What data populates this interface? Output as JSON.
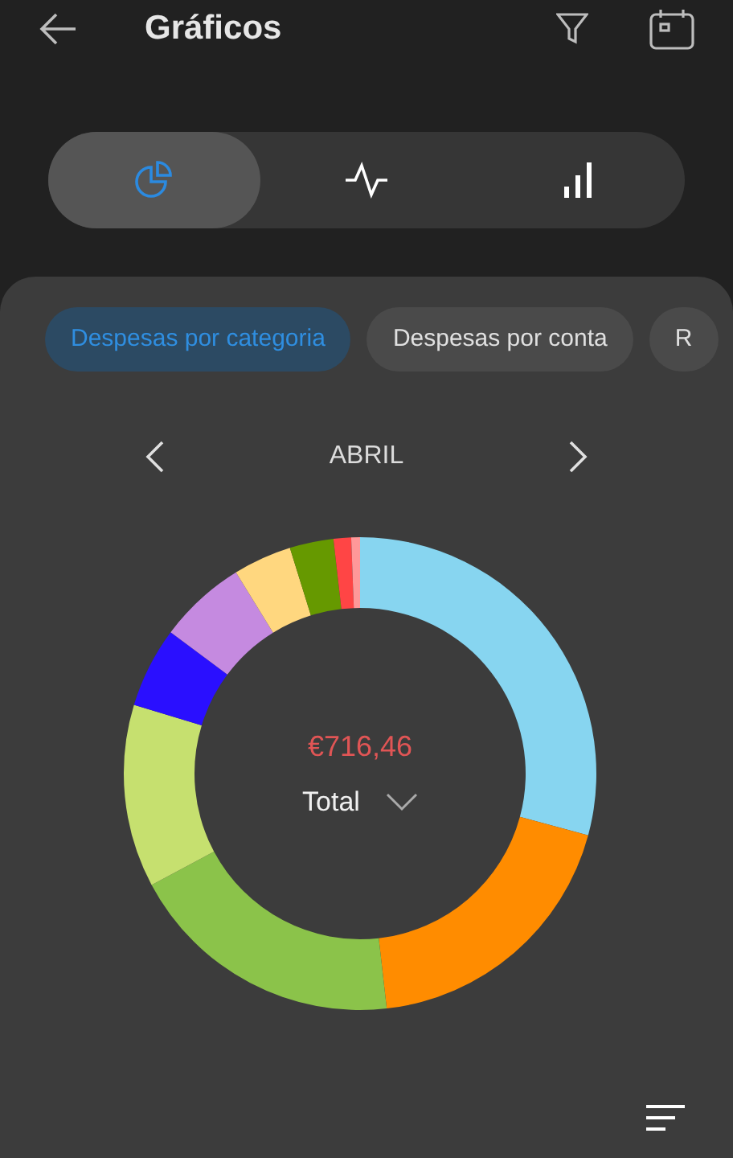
{
  "header": {
    "title": "Gráficos"
  },
  "chart_types": [
    {
      "kind": "pie",
      "selected": true
    },
    {
      "kind": "line",
      "selected": false
    },
    {
      "kind": "bars",
      "selected": false
    }
  ],
  "chips": [
    {
      "label": "Despesas por categoria",
      "selected": true
    },
    {
      "label": "Despesas por conta",
      "selected": false
    },
    {
      "label": "R",
      "selected": false
    }
  ],
  "period": {
    "month": "ABRIL"
  },
  "summary": {
    "amount": "€716,46",
    "label": "Total"
  }
}
